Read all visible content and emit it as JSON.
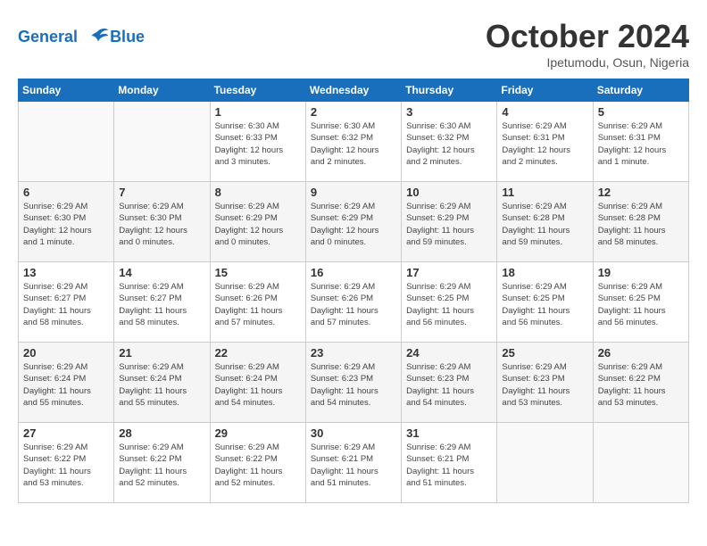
{
  "header": {
    "logo_line1": "General",
    "logo_line2": "Blue",
    "month_title": "October 2024",
    "location": "Ipetumodu, Osun, Nigeria"
  },
  "days_of_week": [
    "Sunday",
    "Monday",
    "Tuesday",
    "Wednesday",
    "Thursday",
    "Friday",
    "Saturday"
  ],
  "weeks": [
    [
      {
        "day": "",
        "info": ""
      },
      {
        "day": "",
        "info": ""
      },
      {
        "day": "1",
        "info": "Sunrise: 6:30 AM\nSunset: 6:33 PM\nDaylight: 12 hours\nand 3 minutes."
      },
      {
        "day": "2",
        "info": "Sunrise: 6:30 AM\nSunset: 6:32 PM\nDaylight: 12 hours\nand 2 minutes."
      },
      {
        "day": "3",
        "info": "Sunrise: 6:30 AM\nSunset: 6:32 PM\nDaylight: 12 hours\nand 2 minutes."
      },
      {
        "day": "4",
        "info": "Sunrise: 6:29 AM\nSunset: 6:31 PM\nDaylight: 12 hours\nand 2 minutes."
      },
      {
        "day": "5",
        "info": "Sunrise: 6:29 AM\nSunset: 6:31 PM\nDaylight: 12 hours\nand 1 minute."
      }
    ],
    [
      {
        "day": "6",
        "info": "Sunrise: 6:29 AM\nSunset: 6:30 PM\nDaylight: 12 hours\nand 1 minute."
      },
      {
        "day": "7",
        "info": "Sunrise: 6:29 AM\nSunset: 6:30 PM\nDaylight: 12 hours\nand 0 minutes."
      },
      {
        "day": "8",
        "info": "Sunrise: 6:29 AM\nSunset: 6:29 PM\nDaylight: 12 hours\nand 0 minutes."
      },
      {
        "day": "9",
        "info": "Sunrise: 6:29 AM\nSunset: 6:29 PM\nDaylight: 12 hours\nand 0 minutes."
      },
      {
        "day": "10",
        "info": "Sunrise: 6:29 AM\nSunset: 6:29 PM\nDaylight: 11 hours\nand 59 minutes."
      },
      {
        "day": "11",
        "info": "Sunrise: 6:29 AM\nSunset: 6:28 PM\nDaylight: 11 hours\nand 59 minutes."
      },
      {
        "day": "12",
        "info": "Sunrise: 6:29 AM\nSunset: 6:28 PM\nDaylight: 11 hours\nand 58 minutes."
      }
    ],
    [
      {
        "day": "13",
        "info": "Sunrise: 6:29 AM\nSunset: 6:27 PM\nDaylight: 11 hours\nand 58 minutes."
      },
      {
        "day": "14",
        "info": "Sunrise: 6:29 AM\nSunset: 6:27 PM\nDaylight: 11 hours\nand 58 minutes."
      },
      {
        "day": "15",
        "info": "Sunrise: 6:29 AM\nSunset: 6:26 PM\nDaylight: 11 hours\nand 57 minutes."
      },
      {
        "day": "16",
        "info": "Sunrise: 6:29 AM\nSunset: 6:26 PM\nDaylight: 11 hours\nand 57 minutes."
      },
      {
        "day": "17",
        "info": "Sunrise: 6:29 AM\nSunset: 6:25 PM\nDaylight: 11 hours\nand 56 minutes."
      },
      {
        "day": "18",
        "info": "Sunrise: 6:29 AM\nSunset: 6:25 PM\nDaylight: 11 hours\nand 56 minutes."
      },
      {
        "day": "19",
        "info": "Sunrise: 6:29 AM\nSunset: 6:25 PM\nDaylight: 11 hours\nand 56 minutes."
      }
    ],
    [
      {
        "day": "20",
        "info": "Sunrise: 6:29 AM\nSunset: 6:24 PM\nDaylight: 11 hours\nand 55 minutes."
      },
      {
        "day": "21",
        "info": "Sunrise: 6:29 AM\nSunset: 6:24 PM\nDaylight: 11 hours\nand 55 minutes."
      },
      {
        "day": "22",
        "info": "Sunrise: 6:29 AM\nSunset: 6:24 PM\nDaylight: 11 hours\nand 54 minutes."
      },
      {
        "day": "23",
        "info": "Sunrise: 6:29 AM\nSunset: 6:23 PM\nDaylight: 11 hours\nand 54 minutes."
      },
      {
        "day": "24",
        "info": "Sunrise: 6:29 AM\nSunset: 6:23 PM\nDaylight: 11 hours\nand 54 minutes."
      },
      {
        "day": "25",
        "info": "Sunrise: 6:29 AM\nSunset: 6:23 PM\nDaylight: 11 hours\nand 53 minutes."
      },
      {
        "day": "26",
        "info": "Sunrise: 6:29 AM\nSunset: 6:22 PM\nDaylight: 11 hours\nand 53 minutes."
      }
    ],
    [
      {
        "day": "27",
        "info": "Sunrise: 6:29 AM\nSunset: 6:22 PM\nDaylight: 11 hours\nand 53 minutes."
      },
      {
        "day": "28",
        "info": "Sunrise: 6:29 AM\nSunset: 6:22 PM\nDaylight: 11 hours\nand 52 minutes."
      },
      {
        "day": "29",
        "info": "Sunrise: 6:29 AM\nSunset: 6:22 PM\nDaylight: 11 hours\nand 52 minutes."
      },
      {
        "day": "30",
        "info": "Sunrise: 6:29 AM\nSunset: 6:21 PM\nDaylight: 11 hours\nand 51 minutes."
      },
      {
        "day": "31",
        "info": "Sunrise: 6:29 AM\nSunset: 6:21 PM\nDaylight: 11 hours\nand 51 minutes."
      },
      {
        "day": "",
        "info": ""
      },
      {
        "day": "",
        "info": ""
      }
    ]
  ]
}
